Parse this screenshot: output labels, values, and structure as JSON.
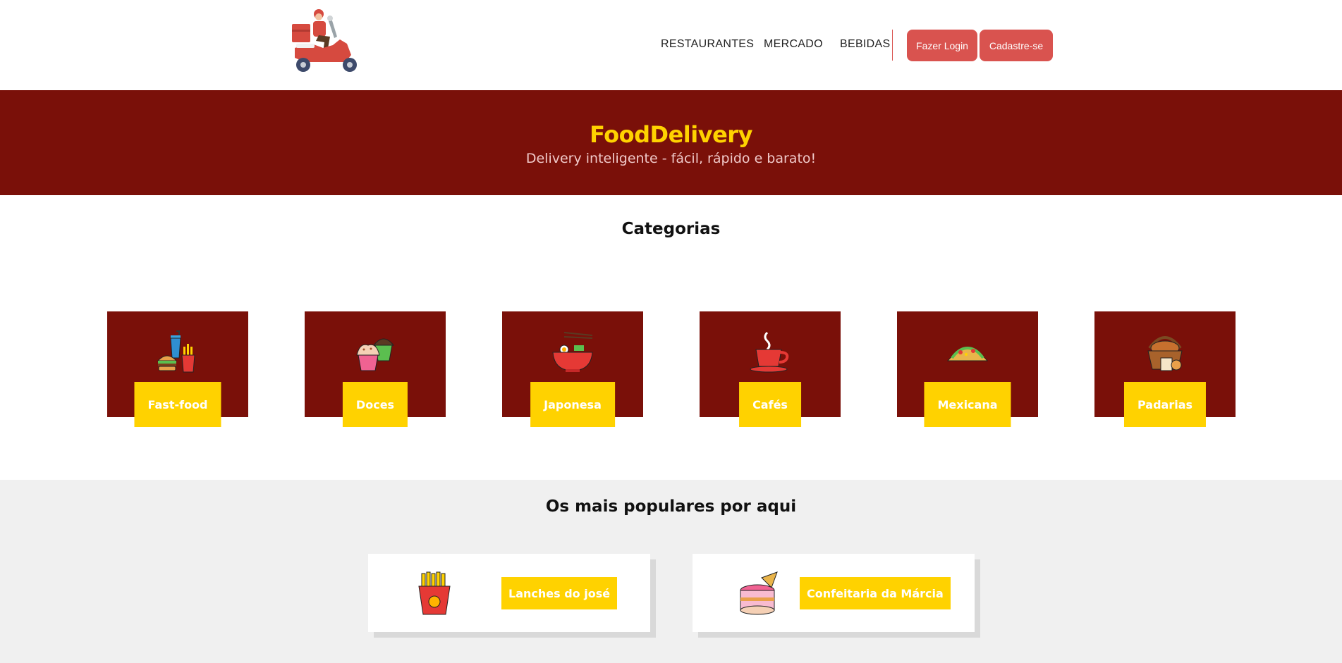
{
  "nav": {
    "links": [
      "RESTAURANTES",
      "MERCADO",
      "BEBIDAS"
    ],
    "login_label": "Fazer Login",
    "signup_label": "Cadastre-se",
    "accent": "#d9534f"
  },
  "hero": {
    "title": "FoodDelivery",
    "subtitle": "Delivery inteligente - fácil, rápido e barato!",
    "background": "#7a1009",
    "title_color": "#ffd200"
  },
  "categories": {
    "title": "Categorias",
    "items": [
      {
        "label": "Fast-food",
        "icon": "fast-food-icon"
      },
      {
        "label": "Doces",
        "icon": "cupcake-icon"
      },
      {
        "label": "Japonesa",
        "icon": "ramen-bowl-icon"
      },
      {
        "label": "Cafés",
        "icon": "coffee-cup-icon"
      },
      {
        "label": "Mexicana",
        "icon": "taco-icon"
      },
      {
        "label": "Padarias",
        "icon": "bread-basket-icon"
      }
    ]
  },
  "popular": {
    "title": "Os mais populares por aqui",
    "items": [
      {
        "label": "Lanches do josé",
        "icon": "french-fries-icon"
      },
      {
        "label": "Confeitaria da Márcia",
        "icon": "cake-icon"
      }
    ]
  },
  "logo": {
    "icon": "delivery-scooter-logo"
  }
}
